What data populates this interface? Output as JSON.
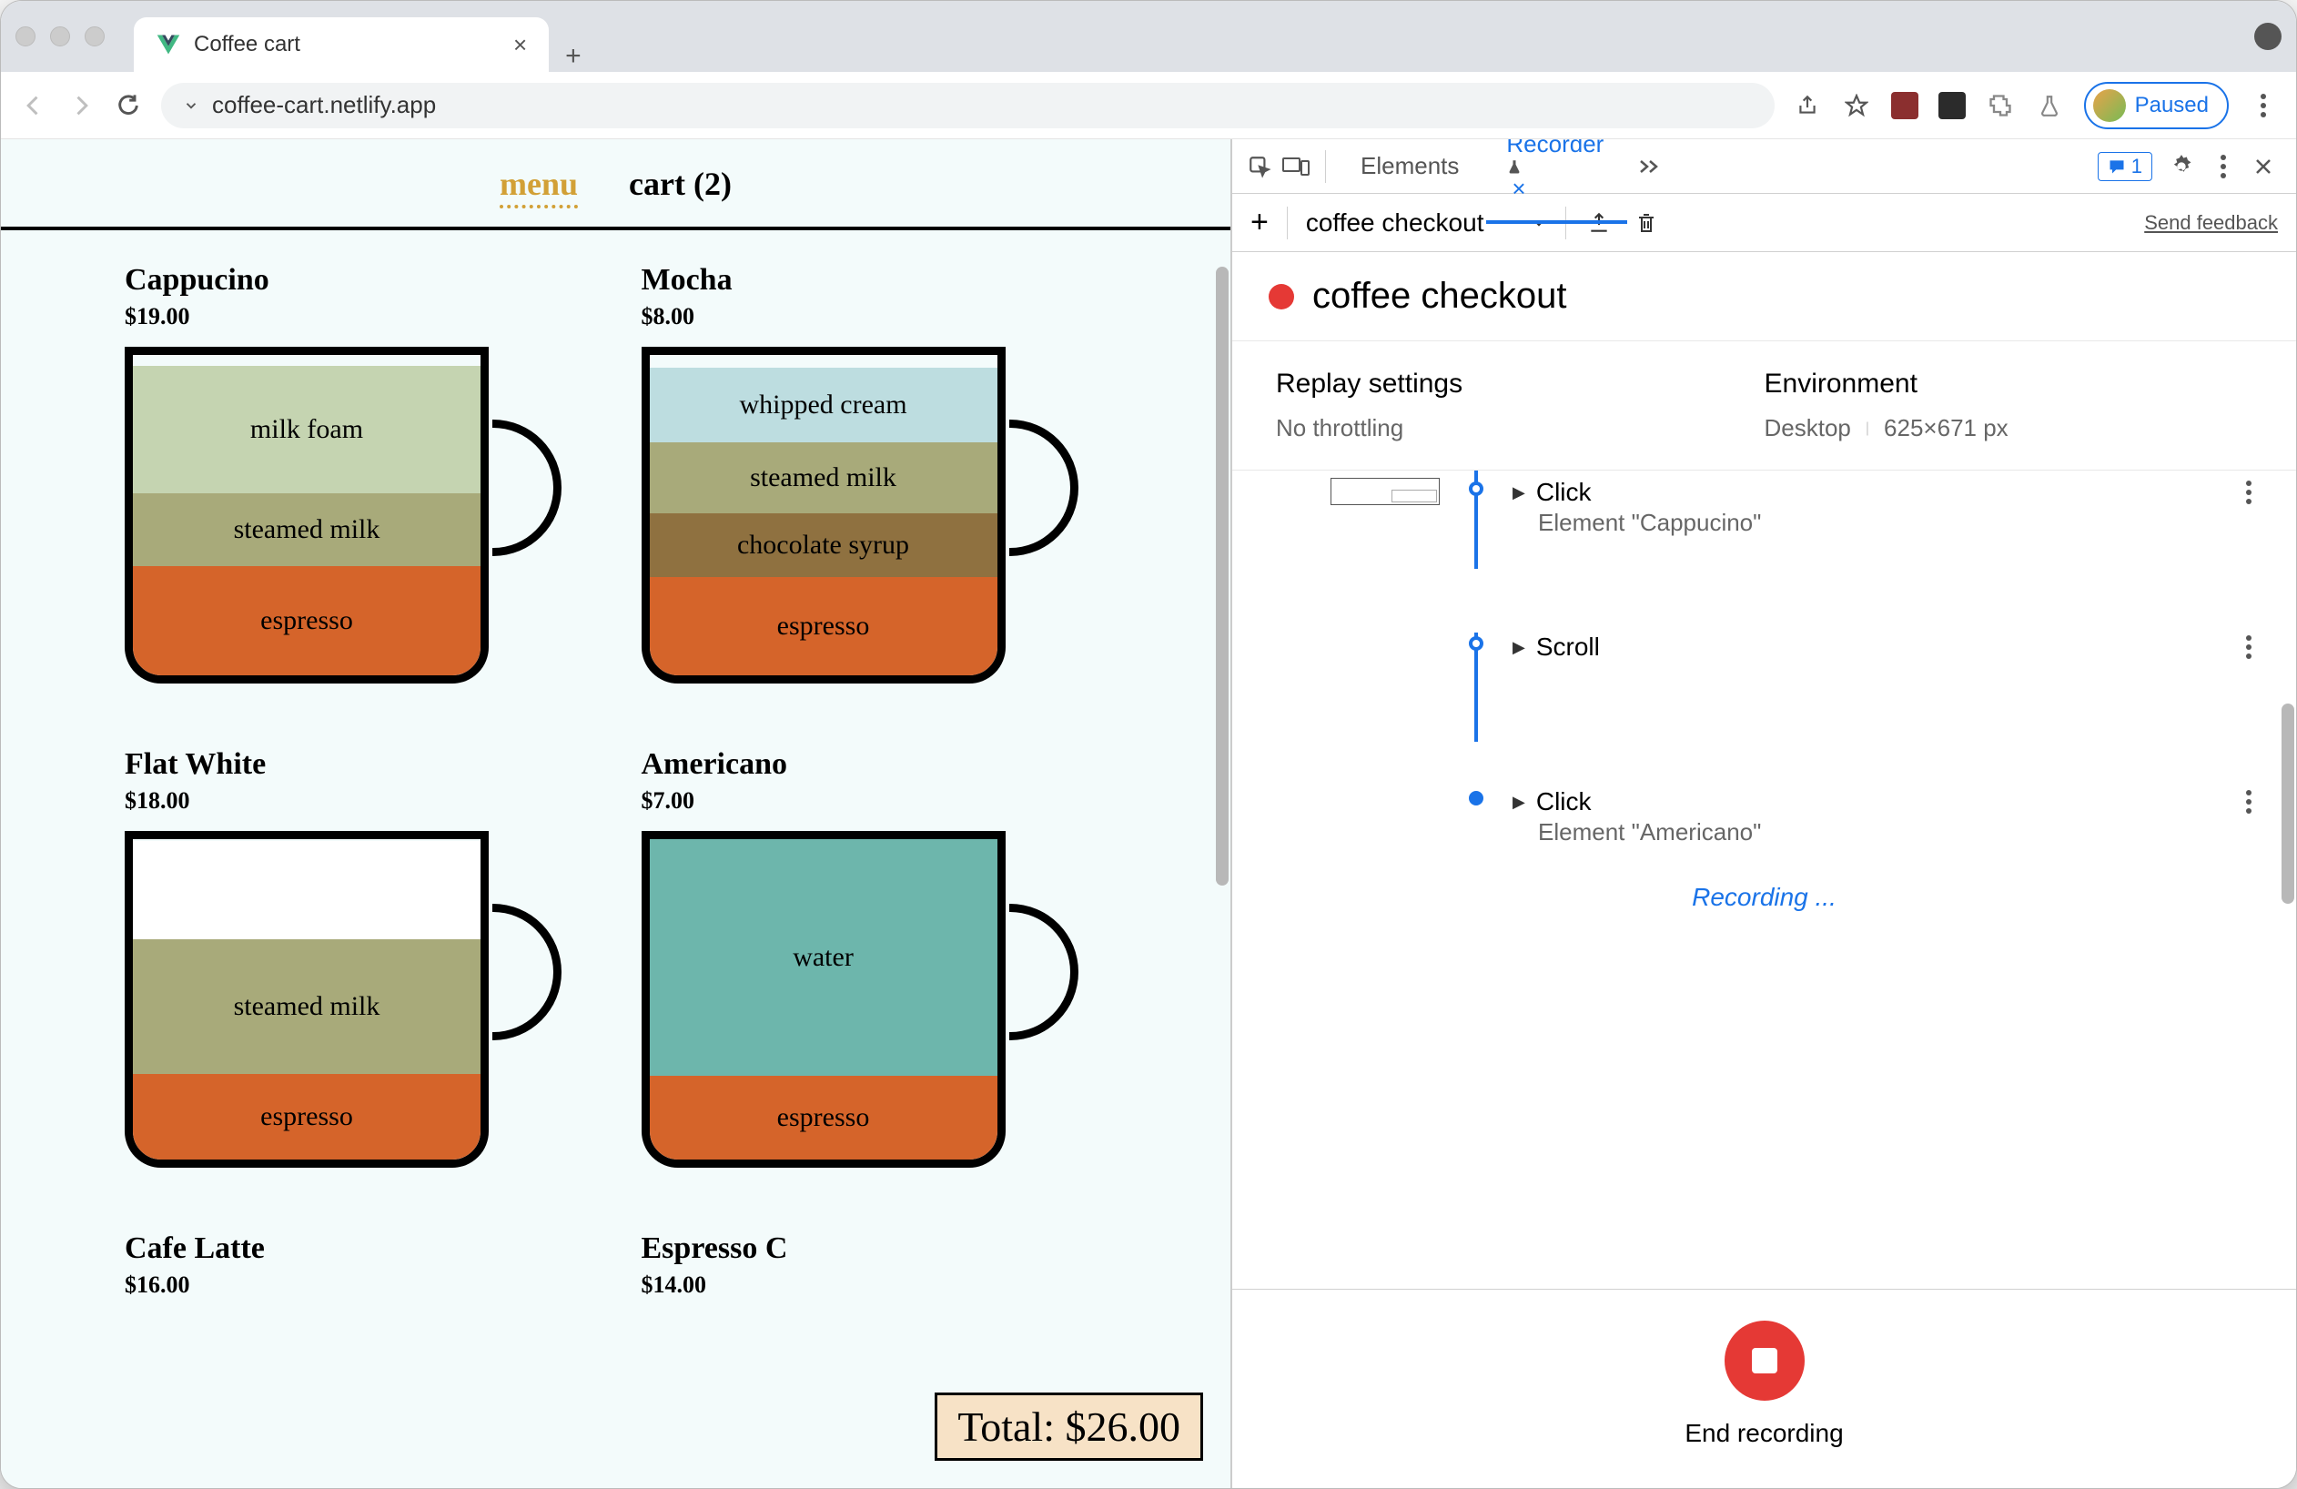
{
  "browser": {
    "tab_title": "Coffee cart",
    "url": "coffee-cart.netlify.app",
    "paused_label": "Paused"
  },
  "page": {
    "nav": {
      "menu": "menu",
      "cart": "cart (2)"
    },
    "total_label": "Total: $26.00",
    "products": [
      {
        "name": "Cappucino",
        "price": "$19.00",
        "layers": [
          {
            "label": "milk foam",
            "color": "#c5d4b1",
            "hpx": 140
          },
          {
            "label": "steamed milk",
            "color": "#a8aa7a",
            "hpx": 80
          },
          {
            "label": "espresso",
            "color": "#d5642a",
            "hpx": 120
          }
        ]
      },
      {
        "name": "Mocha",
        "price": "$8.00",
        "layers": [
          {
            "label": "whipped cream",
            "color": "#bddde0",
            "hpx": 82
          },
          {
            "label": "steamed milk",
            "color": "#a8aa7a",
            "hpx": 78
          },
          {
            "label": "chocolate syrup",
            "color": "#8f7140",
            "hpx": 70
          },
          {
            "label": "espresso",
            "color": "#d5642a",
            "hpx": 108
          }
        ]
      },
      {
        "name": "Flat White",
        "price": "$18.00",
        "layers": [
          {
            "label": "",
            "color": "#ffffff",
            "hpx": 108
          },
          {
            "label": "steamed milk",
            "color": "#a8aa7a",
            "hpx": 148
          },
          {
            "label": "espresso",
            "color": "#d5642a",
            "hpx": 94
          }
        ]
      },
      {
        "name": "Americano",
        "price": "$7.00",
        "layers": [
          {
            "label": "water",
            "color": "#6db6ac",
            "hpx": 260
          },
          {
            "label": "espresso",
            "color": "#d5642a",
            "hpx": 92
          }
        ]
      },
      {
        "name": "Cafe Latte",
        "price": "$16.00",
        "layers": []
      },
      {
        "name": "Espresso C",
        "price": "$14.00",
        "layers": []
      }
    ]
  },
  "devtools": {
    "tabs": {
      "elements": "Elements",
      "recorder": "Recorder"
    },
    "msg_count": "1",
    "flow_name": "coffee checkout",
    "send_feedback": "Send feedback",
    "recording_title": "coffee checkout",
    "settings": {
      "replay_label": "Replay settings",
      "throttling": "No throttling",
      "env_label": "Environment",
      "device": "Desktop",
      "viewport": "625×671 px"
    },
    "steps": [
      {
        "action": "Click",
        "sub": "Element \"Cappucino\"",
        "thumb": true,
        "partial": true
      },
      {
        "action": "Scroll",
        "sub": ""
      },
      {
        "action": "Click",
        "sub": "Element \"Americano\"",
        "end": true
      }
    ],
    "recording_label": "Recording ...",
    "end_label": "End recording"
  }
}
